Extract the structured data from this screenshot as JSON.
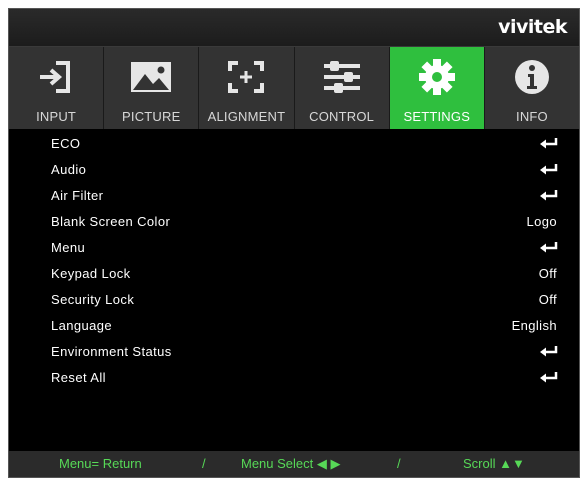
{
  "brand": "vivitek",
  "tabs": [
    {
      "label": "INPUT",
      "icon": "input-icon",
      "active": false
    },
    {
      "label": "PICTURE",
      "icon": "picture-icon",
      "active": false
    },
    {
      "label": "ALIGNMENT",
      "icon": "alignment-icon",
      "active": false
    },
    {
      "label": "CONTROL",
      "icon": "control-sliders-icon",
      "active": false
    },
    {
      "label": "SETTINGS",
      "icon": "gear-icon",
      "active": true
    },
    {
      "label": "INFO",
      "icon": "info-icon",
      "active": false
    }
  ],
  "menu": [
    {
      "label": "ECO",
      "value": null,
      "icon": "enter-icon"
    },
    {
      "label": "Audio",
      "value": null,
      "icon": "enter-icon"
    },
    {
      "label": "Air Filter",
      "value": null,
      "icon": "enter-icon"
    },
    {
      "label": "Blank Screen Color",
      "value": "Logo"
    },
    {
      "label": "Menu",
      "value": null,
      "icon": "enter-icon"
    },
    {
      "label": "Keypad Lock",
      "value": "Off"
    },
    {
      "label": "Security Lock",
      "value": "Off"
    },
    {
      "label": "Language",
      "value": "English"
    },
    {
      "label": "Environment Status",
      "value": null,
      "icon": "enter-icon"
    },
    {
      "label": "Reset All",
      "value": null,
      "icon": "enter-icon"
    }
  ],
  "footer": {
    "return": "Menu= Return",
    "sep1": "/",
    "select": "Menu Select ◀ ▶",
    "sep2": "/",
    "scroll": "Scroll ▲▼"
  },
  "colors": {
    "active_tab": "#2fbf3e",
    "footer_text": "#57d957",
    "background": "#000000"
  }
}
